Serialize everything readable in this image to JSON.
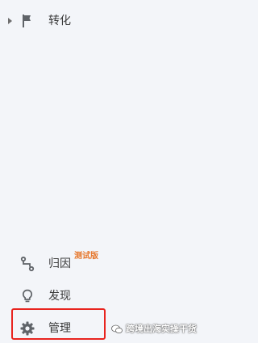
{
  "nav": {
    "conversions": {
      "label": "转化",
      "icon": "flag-icon"
    },
    "attribution": {
      "label": "归因",
      "badge": "测试版",
      "icon": "attribution-path-icon"
    },
    "discover": {
      "label": "发现",
      "icon": "lightbulb-icon"
    },
    "admin": {
      "label": "管理",
      "icon": "gear-icon"
    }
  },
  "watermark": {
    "text": "跨境出海实操干货",
    "icon": "wechat-icon"
  },
  "colors": {
    "background": "#f3f5f9",
    "icon": "#5f6368",
    "badge": "#e6762b",
    "highlight": "#e8241f"
  }
}
